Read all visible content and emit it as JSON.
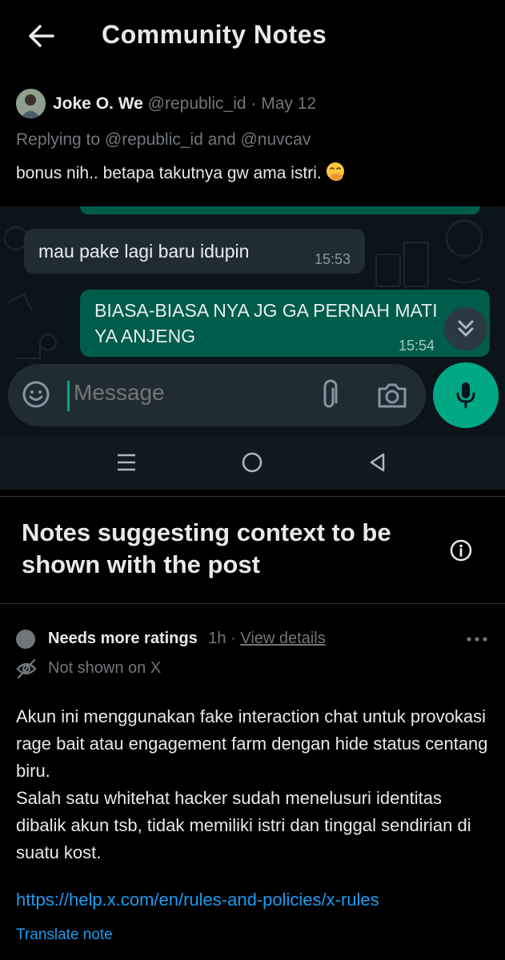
{
  "header": {
    "title": "Community Notes"
  },
  "post": {
    "author_name": "Joke O. We",
    "author_handle": "@republic_id",
    "separator": "·",
    "date": "May 12",
    "replying_to": "Replying to @republic_id and @nuvcav",
    "text": "bonus nih.. betapa takutnya gw ama istri.",
    "emoji": "face-with-hand-over-mouth"
  },
  "screenshot": {
    "incoming_message": "mau pake lagi baru idupin",
    "incoming_time": "15:53",
    "outgoing_message": "BIASA-BIASA NYA JG GA PERNAH MATI YA ANJENG",
    "outgoing_time": "15:54",
    "input_placeholder": "Message",
    "colors": {
      "outgoing_bubble": "#005c4b",
      "incoming_bubble": "#202c33",
      "accent": "#00a884"
    }
  },
  "notes_section": {
    "title": "Notes suggesting context to be shown with the post"
  },
  "note": {
    "status": "Needs more ratings",
    "age": "1h",
    "separator": "·",
    "view_details": "View details",
    "visibility": "Not shown on X",
    "body": "Akun ini menggunakan fake interaction chat untuk provokasi rage bait atau engagement farm dengan hide status centang biru.\nSalah satu whitehat hacker sudah menelusuri identitas dibalik akun tsb, tidak memiliki istri dan tinggal sendirian di suatu kost.",
    "link": "https://help.x.com/en/rules-and-policies/x-rules",
    "translate_label": "Translate note"
  },
  "theme": {
    "background": "#000000",
    "text": "#e7e9ea",
    "muted": "#71767b",
    "link": "#1d9bf0",
    "divider": "#2f3336"
  }
}
